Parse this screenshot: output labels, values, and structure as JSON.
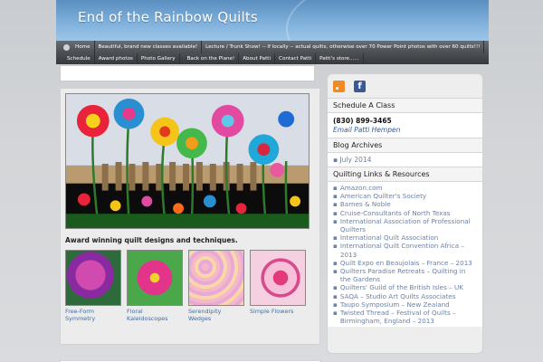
{
  "site": {
    "title": "End of the Rainbow Quilts"
  },
  "nav_primary": [
    "Home",
    "Beautiful, brand new classes available!",
    "Lecture / Trunk Show! -- if locally -- actual quilts, otherwise over 70 Power Point photos with over 60 quilts!!!"
  ],
  "nav_secondary": [
    "Schedule",
    "Award photos",
    "Photo Gallery",
    "Back on the Plane!",
    "About Patti",
    "Contact Patti",
    "Patti's store......"
  ],
  "main": {
    "tagline": "Award winning quilt designs and techniques.",
    "thumbs": [
      {
        "caption": "Free-Form Symmetry"
      },
      {
        "caption": "Floral Kaleidoscopes"
      },
      {
        "caption": "Serendipity Wedges"
      },
      {
        "caption": "Simple Flowers"
      }
    ]
  },
  "sidebar": {
    "icons": [
      "rss-icon",
      "facebook-icon"
    ],
    "facebook_letter": "f",
    "schedule_title": "Schedule A Class",
    "phone": "(830) 899-3465",
    "email": "Email Patti Hempen",
    "archives_title": "Blog Archives",
    "archive_item": "July 2014",
    "links_title": "Quilting Links & Resources",
    "links": [
      "Amazon.com",
      "American Quilter's Society",
      "Barnes & Noble",
      "Cruise-Consultants of North Texas",
      "International Association of Professional Quilters",
      "International Quilt Association",
      "International Quilt Convention Africa – 2013",
      "Quilt Expo en Beaujolais – France – 2013",
      "Quilters Paradise Retreats – Quilting in the Gardens",
      "Quilters' Guild of the British Isles – UK",
      "SAQA – Studio Art Quilts Associates",
      "Taupo Symposium – New Zealand",
      "Twisted Thread – Festival of Quilts – Birmingham, England – 2013"
    ]
  },
  "colors": {
    "accent_link": "#3b6eab",
    "header_blue": "#7fb0db",
    "nav_dark": "#4a4d51"
  }
}
